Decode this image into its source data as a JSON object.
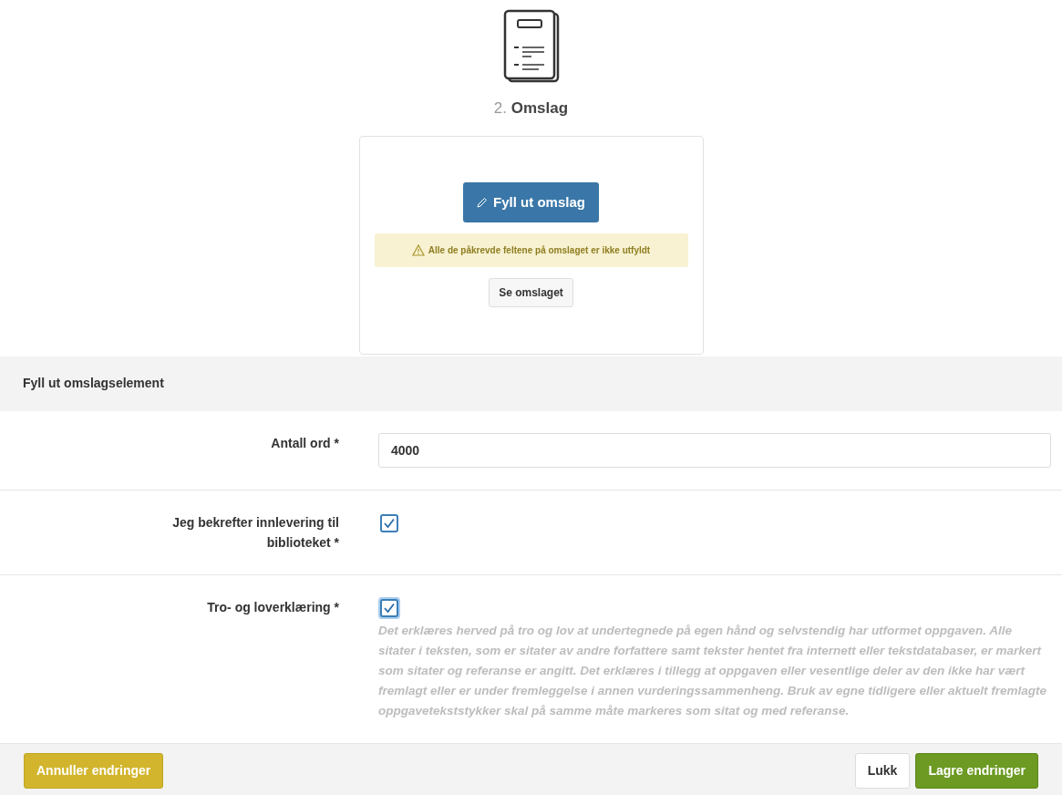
{
  "step": {
    "number": "2.",
    "title": "Omslag"
  },
  "card": {
    "fill_button": "Fyll ut omslag",
    "warning": "Alle de påkrevde feltene på omslaget er ikke utfyldt",
    "view_button": "Se omslaget"
  },
  "section": {
    "title": "Fyll ut omslagselement"
  },
  "fields": [
    {
      "kind": "text",
      "label": "Antall ord *",
      "value": "4000"
    },
    {
      "kind": "checkbox",
      "label": "Jeg bekrefter innlevering til biblioteket *",
      "checked": true,
      "focused": false
    },
    {
      "kind": "checkbox",
      "label": "Tro- og loverklæring *",
      "checked": true,
      "focused": true,
      "description": "Det erklæres herved på tro og lov at undertegnede på egen hånd og selvstendig har utformet oppgaven. Alle sitater i teksten, som er sitater av andre forfattere samt tekster hentet fra internett eller tekstdatabaser, er markert som sitater og referanse er angitt. Det erklæres i tillegg at oppgaven eller vesentlige deler av den ikke har vært fremlagt eller er under fremleggelse i annen vurderingssammenheng. Bruk av egne tidligere eller aktuelt fremlagte oppgavetekststykker skal på samme måte markeres som sitat og med referanse."
    }
  ],
  "footer": {
    "buttons": [
      {
        "kind": "warning",
        "label": "Annuller endringer"
      },
      {
        "kind": "default",
        "label": "Lukk"
      },
      {
        "kind": "success",
        "label": "Lagre endringer"
      }
    ]
  }
}
